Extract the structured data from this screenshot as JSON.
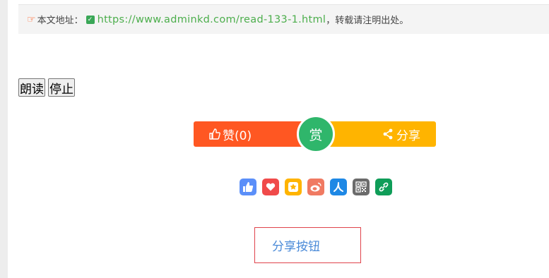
{
  "address": {
    "label": "本文地址：",
    "url": "https://www.adminkd.com/read-133-1.html",
    "suffix": "，转载请注明出处。"
  },
  "tts": {
    "read_label": "朗读",
    "stop_label": "停止"
  },
  "actions": {
    "like_label": "赞(0)",
    "reward_label": "赏",
    "share_label": "分享"
  },
  "share_icons": [
    {
      "name": "like-share-icon",
      "color": "#5b8ff9"
    },
    {
      "name": "heart-share-icon",
      "color": "#f04a4a"
    },
    {
      "name": "favorite-star-share-icon",
      "color": "#ffb400"
    },
    {
      "name": "weibo-share-icon",
      "color": "#f07a62"
    },
    {
      "name": "renren-share-icon",
      "color": "#1e88e5"
    },
    {
      "name": "qrcode-share-icon",
      "color": "#6b6b6b"
    },
    {
      "name": "link-share-icon",
      "color": "#0f9d58"
    }
  ],
  "share_button": {
    "label": "分享按钮"
  }
}
